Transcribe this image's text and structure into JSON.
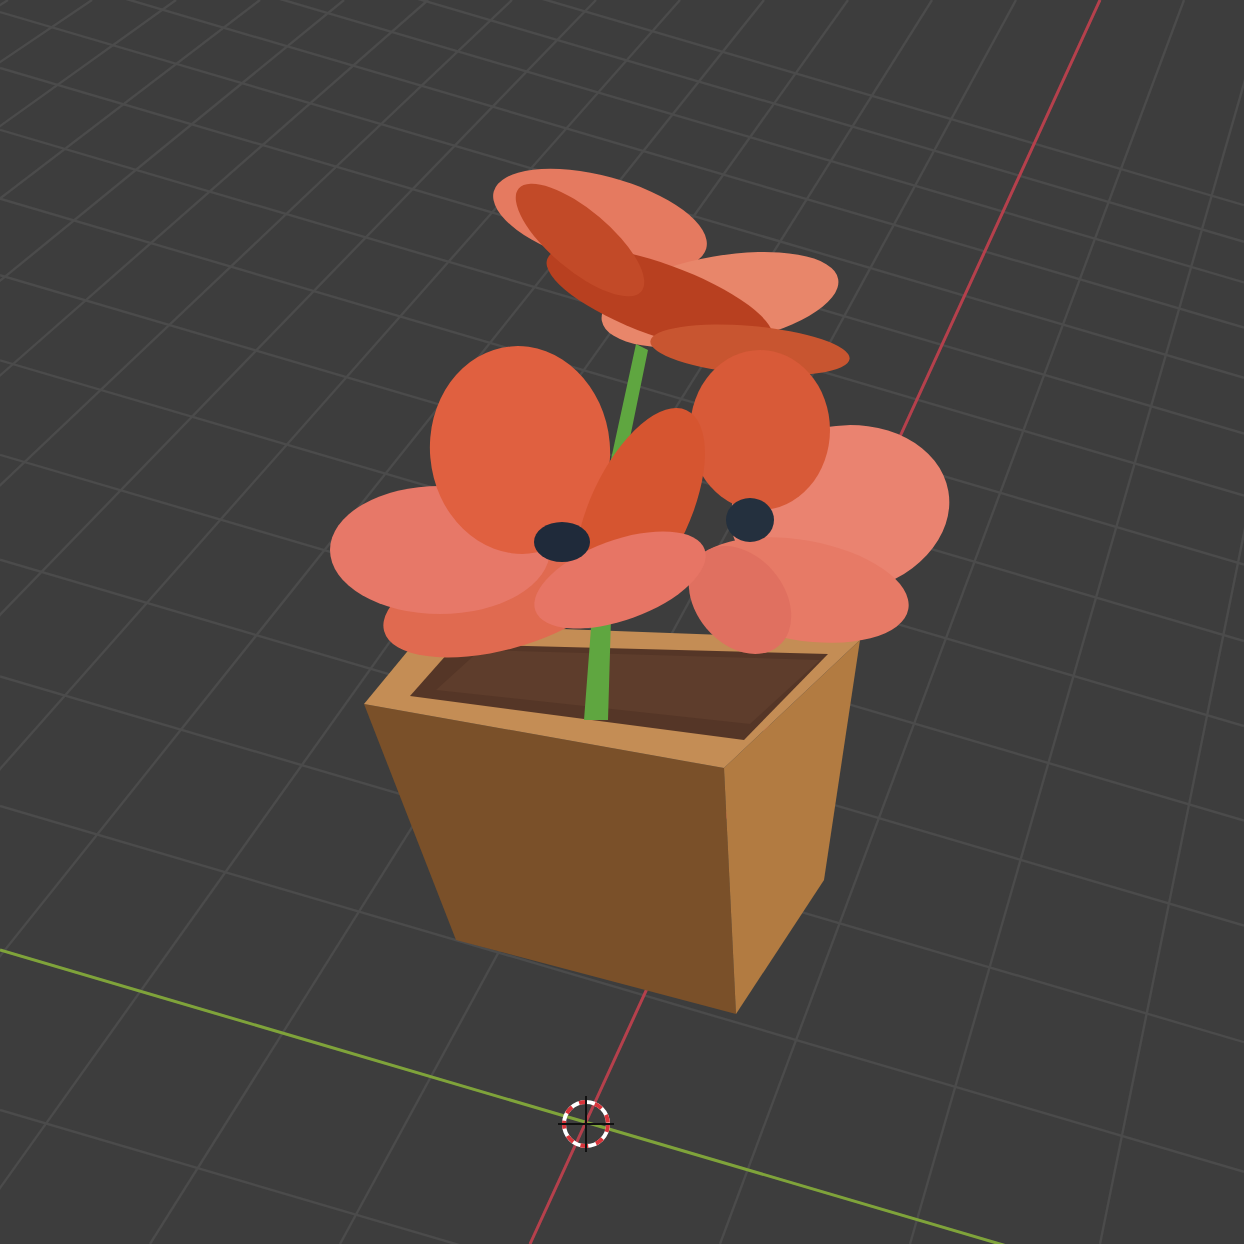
{
  "viewport": {
    "axes": [
      {
        "kind": "x",
        "color": "#7fa33a"
      },
      {
        "kind": "y",
        "color": "#b5404c"
      }
    ]
  }
}
